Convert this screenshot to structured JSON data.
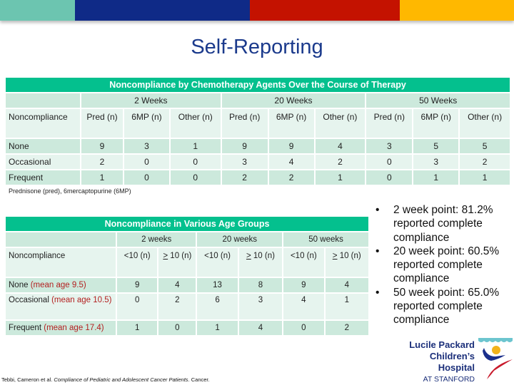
{
  "topbar": {
    "colors": [
      "#6cc5b0",
      "#0f2a87",
      "#c41200",
      "#ffb800"
    ]
  },
  "title": "Self-Reporting",
  "table1": {
    "title": "Noncompliance by Chemotherapy Agents Over the Course of Therapy",
    "periods": [
      "2 Weeks",
      "20 Weeks",
      "50 Weeks"
    ],
    "row_header": "Noncompliance",
    "columns": [
      "Pred (n)",
      "6MP (n)",
      "Other (n)",
      "Pred (n)",
      "6MP (n)",
      "Other (n)",
      "Pred (n)",
      "6MP (n)",
      "Other (n)"
    ],
    "rows": [
      {
        "label": "None",
        "values": [
          "9",
          "3",
          "1",
          "9",
          "9",
          "4",
          "3",
          "5",
          "5"
        ]
      },
      {
        "label": "Occasional",
        "values": [
          "2",
          "0",
          "0",
          "3",
          "4",
          "2",
          "0",
          "3",
          "2"
        ]
      },
      {
        "label": "Frequent",
        "values": [
          "1",
          "0",
          "0",
          "2",
          "2",
          "1",
          "0",
          "1",
          "1"
        ]
      }
    ],
    "footnote": "Prednisone (pred), 6mercaptopurine (6MP)"
  },
  "table2": {
    "title": "Noncompliance in Various Age Groups",
    "periods": [
      "2 weeks",
      "20 weeks",
      "50 weeks"
    ],
    "row_header": "Noncompliance",
    "columns": [
      "<10 (n)",
      "> 10 (n)",
      "<10 (n)",
      "> 10 (n)",
      "<10 (n)",
      "> 10 (n)"
    ],
    "rows": [
      {
        "label": "None",
        "note": "(mean age 9.5)",
        "values": [
          "9",
          "4",
          "13",
          "8",
          "9",
          "4"
        ]
      },
      {
        "label": "Occasional",
        "note": "(mean age 10.5)",
        "values": [
          "0",
          "2",
          "6",
          "3",
          "4",
          "1"
        ]
      },
      {
        "label": "Frequent",
        "note": "(mean age 17.4)",
        "values": [
          "1",
          "0",
          "1",
          "4",
          "0",
          "2"
        ]
      }
    ]
  },
  "bullets": [
    "2 week point:  81.2% reported complete compliance",
    "20 week point:  60.5% reported complete compliance",
    "50 week point: 65.0% reported complete compliance"
  ],
  "citation": {
    "authors": "Tebbi, Cameron et al.",
    "title": "Compliance of Pediatric and Adolescent Cancer Patients",
    "journal": ". Cancer."
  },
  "logo": {
    "line1": "Lucile Packard",
    "line2": "Children’s Hospital",
    "line3": "AT STANFORD"
  }
}
